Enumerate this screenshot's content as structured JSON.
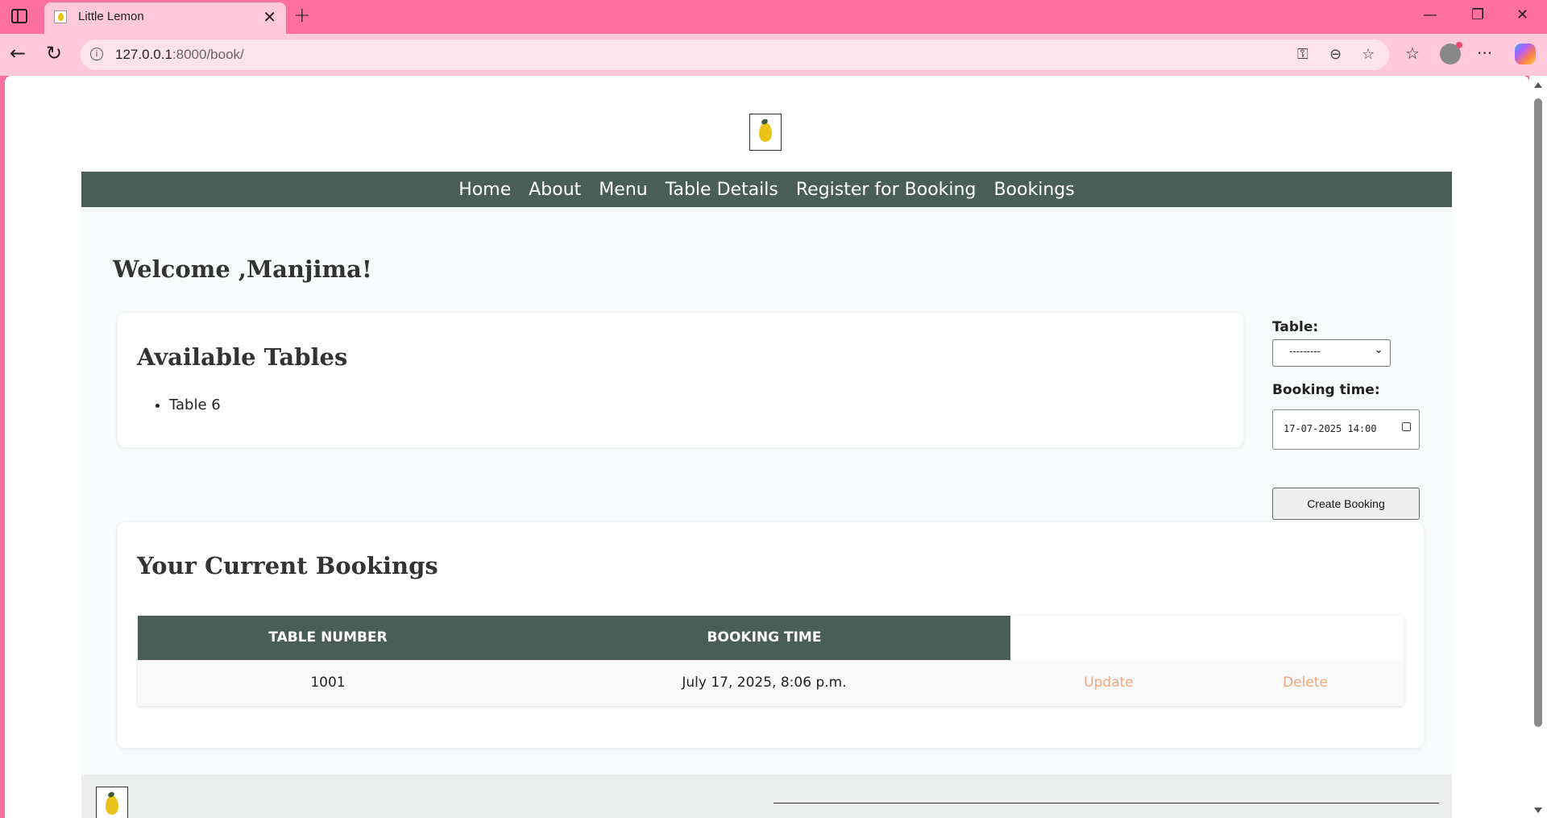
{
  "browser": {
    "tab_title": "Little Lemon",
    "url_host": "127.0.0.1",
    "url_rest": ":8000/book/"
  },
  "nav": {
    "items": [
      "Home",
      "About",
      "Menu",
      "Table Details",
      "Register for Booking",
      "Bookings"
    ]
  },
  "welcome": "Welcome ,Manjima!",
  "available": {
    "title": "Available Tables",
    "items": [
      "Table 6"
    ]
  },
  "form": {
    "table_label": "Table:",
    "table_value": "---------",
    "time_label": "Booking time:",
    "time_value": "17-07-2025 14:00",
    "submit": "Create Booking"
  },
  "bookings": {
    "title": "Your Current Bookings",
    "headers": [
      "TABLE NUMBER",
      "BOOKING TIME"
    ],
    "rows": [
      {
        "table": "1001",
        "time": "July 17, 2025, 8:06 p.m.",
        "update": "Update",
        "delete": "Delete"
      }
    ]
  },
  "colors": {
    "primary": "#495e57",
    "accent": "#f0a67a",
    "browser": "#ff6fa0"
  }
}
